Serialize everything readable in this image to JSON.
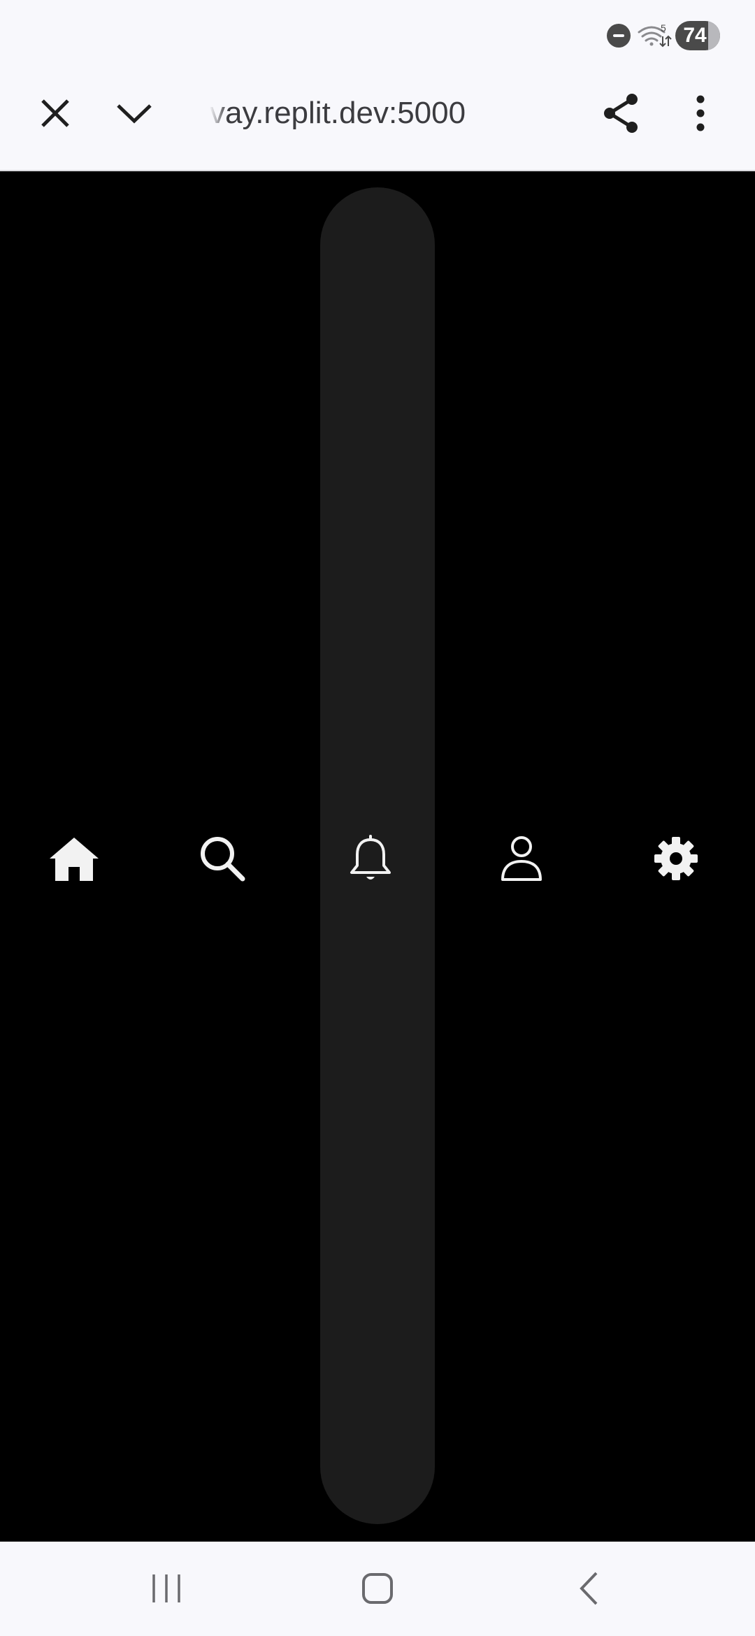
{
  "status_bar": {
    "battery_level": "74",
    "wifi_badge": "5",
    "icons": [
      "do-not-disturb-icon",
      "wifi-icon",
      "battery-icon"
    ]
  },
  "browser": {
    "url": "vay.replit.dev:5000",
    "icons": [
      "close-icon",
      "chevron-down-icon",
      "share-icon",
      "more-vert-icon"
    ]
  },
  "bottom_nav": {
    "items": [
      {
        "icon": "home-icon",
        "label": "home"
      },
      {
        "icon": "search-icon",
        "label": "search"
      },
      {
        "icon": "bell-icon",
        "label": "notifications"
      },
      {
        "icon": "user-icon",
        "label": "profile"
      },
      {
        "icon": "gear-icon",
        "label": "settings"
      }
    ]
  },
  "system_nav": {
    "icons": [
      "recents-icon",
      "home-button-icon",
      "back-icon"
    ]
  },
  "colors": {
    "chrome_bg": "#f8f8fc",
    "content_bg": "#000000",
    "pill_bg": "#1c1c1c",
    "icon_light": "#f2f2f2",
    "icon_dark": "#1f1f1f"
  }
}
